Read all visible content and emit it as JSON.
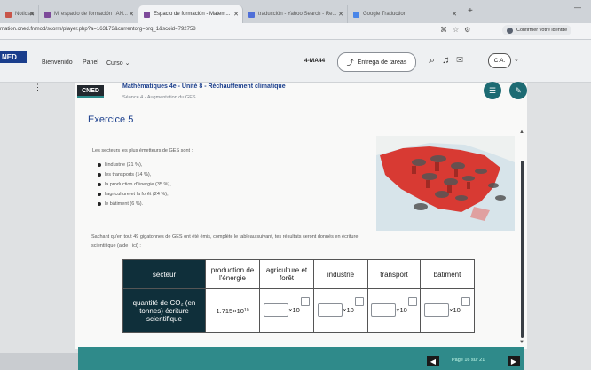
{
  "browser": {
    "tabs": [
      {
        "label": "Noticias",
        "fav": "#c8554a"
      },
      {
        "label": "Mi espacio de formación | AN...",
        "fav": "#7d4a9a"
      },
      {
        "label": "Espacio de formación - Matem...",
        "fav": "#7d4a9a"
      },
      {
        "label": "traducción - Yahoo Search - Re...",
        "fav": "#4f6fd8"
      },
      {
        "label": "Google Traduction",
        "fav": "#4a86e8"
      }
    ],
    "url": "mation.cned.fr/mod/scorm/player.php?a=163173&currentorg=orq_1&scoid=792758",
    "confirm_label": "Confirmer votre identité"
  },
  "nav": {
    "logo": "NED",
    "links": [
      "Bienvenido",
      "Panel",
      "Curso ⌄"
    ],
    "course_code": "4-MA44",
    "submit_label": "Entrega de tareas",
    "avatar": "C.A."
  },
  "module": {
    "logo": "CNED",
    "title": "Mathématiques 4e - Unité 8 - Réchauffement climatique",
    "subtitle": "Séance 4 - Augmentation du GES"
  },
  "exercise": {
    "title": "Exercice 5",
    "intro": "Les secteurs les plus émetteurs de GES sont :",
    "bullets": [
      "l'industrie (21 %),",
      "les transports (14 %),",
      "la production d'énergie (35 %),",
      "l'agriculture et la forêt (24 %),",
      "le bâtiment (6 %)."
    ],
    "paragraph": "Sachant qu'en tout 49 gigatonnes de GES ont été émis, complète le tableau suivant, tes résultats seront donnés en écriture scientifique (aide : ici) :"
  },
  "table": {
    "corner": "secteur",
    "columns": [
      "production de l'énergie",
      "agriculture et forêt",
      "industrie",
      "transport",
      "bâtiment"
    ],
    "row_label": "quantité de CO₂ (en tonnes) écriture scientifique",
    "energy_mantissa": "1.715",
    "energy_base": "×10",
    "energy_exponent": "10",
    "times_ten": "×10"
  },
  "footer": {
    "page_label": "Page 16 sur 21",
    "prev": "◀",
    "next": "▶"
  }
}
